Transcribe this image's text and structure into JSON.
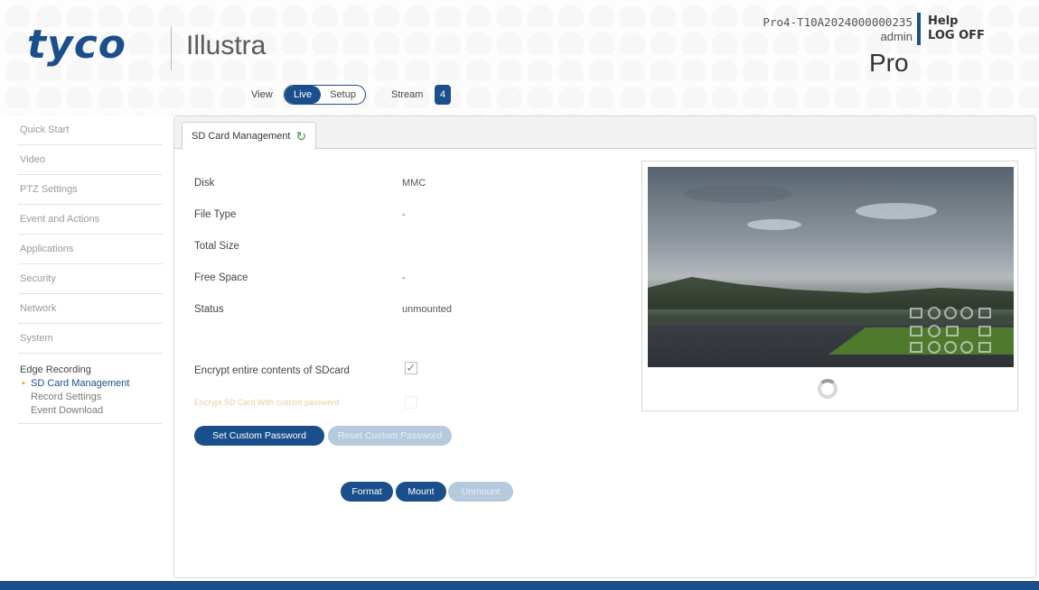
{
  "header": {
    "brand": "tyco",
    "product": "Illustra",
    "device_id": "Pro4-T10A2024000000235",
    "user": "admin",
    "help": "Help",
    "logoff": "LOG OFF",
    "edition": "Pro",
    "view_label": "View",
    "view_live": "Live",
    "view_setup": "Setup",
    "stream_label": "Stream",
    "stream_value": "4"
  },
  "sidebar": {
    "items": [
      {
        "label": "Quick Start"
      },
      {
        "label": "Video"
      },
      {
        "label": "PTZ Settings"
      },
      {
        "label": "Event and Actions"
      },
      {
        "label": "Applications"
      },
      {
        "label": "Security"
      },
      {
        "label": "Network"
      },
      {
        "label": "System"
      }
    ],
    "group": {
      "title": "Edge Recording",
      "items": [
        {
          "label": "SD Card Management",
          "active": true
        },
        {
          "label": "Record Settings",
          "active": false
        },
        {
          "label": "Event Download",
          "active": false
        }
      ]
    }
  },
  "panel": {
    "tab_label": "SD Card Management",
    "fields": [
      {
        "label": "Disk",
        "value": "MMC"
      },
      {
        "label": "File Type",
        "value": "-"
      },
      {
        "label": "Total Size",
        "value": ""
      },
      {
        "label": "Free Space",
        "value": "-"
      },
      {
        "label": "Status",
        "value": "unmounted"
      }
    ],
    "encrypt_label": "Encrypt entire contents of SDcard",
    "encrypt_checked": true,
    "faded_text": "Encrypt SD Card With custom password",
    "set_password_button": "Set Custom Password",
    "reset_password_button": "Reset Custom Password",
    "format_button": "Format",
    "mount_button": "Mount",
    "unmount_button": "Unmount"
  },
  "colors": {
    "brand_blue": "#1a4f8b",
    "disabled_blue": "#b6c9dd",
    "active_dot": "#e0a030",
    "refresh_green": "#3a9a3a"
  }
}
